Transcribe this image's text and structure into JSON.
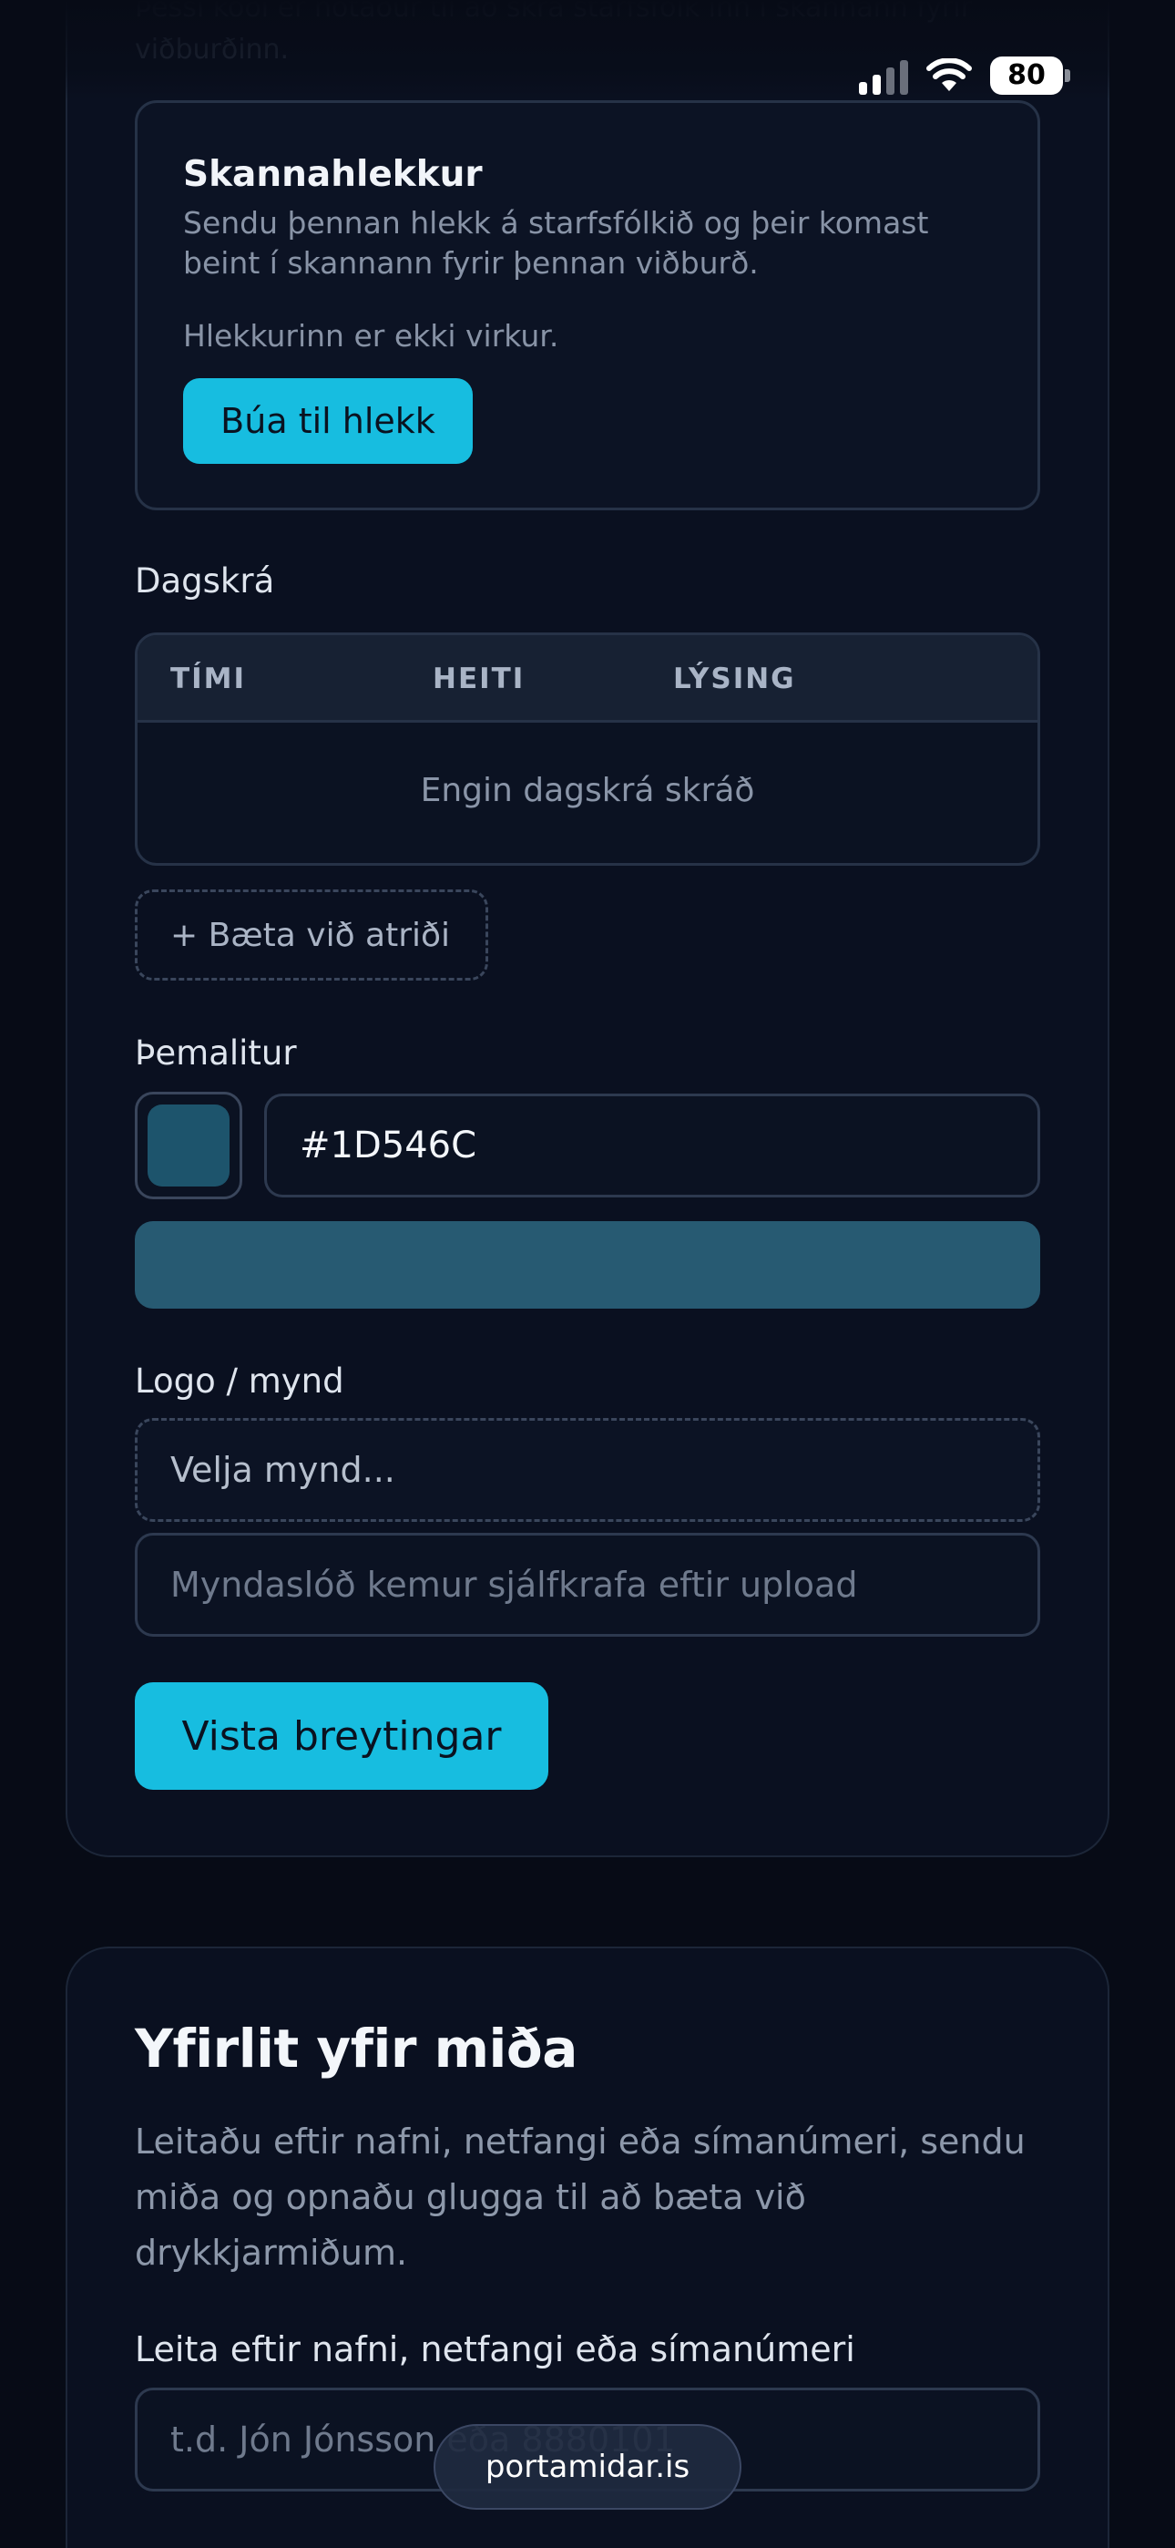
{
  "top_faded_text": "Þessi kóði er notaður til að skrá starfsfólk inn í skannann fyrir viðburðinn.",
  "status_bar": {
    "battery": "80"
  },
  "scan_link": {
    "title": "Skannahlekkur",
    "description": "Sendu þennan hlekk á starfsfólkið og þeir komast beint í skannann fyrir þennan viðburð.",
    "status": "Hlekkurinn er ekki virkur.",
    "button": "Búa til hlekk"
  },
  "agenda": {
    "label": "Dagskrá",
    "columns": [
      "TÍMI",
      "HEITI",
      "LÝSING"
    ],
    "empty": "Engin dagskrá skráð",
    "add_button": "+ Bæta við atriði"
  },
  "theme": {
    "label": "Þemalitur",
    "value": "#1D546C",
    "swatch_color": "#1D546C"
  },
  "logo": {
    "label": "Logo / mynd",
    "file_button": "Velja mynd...",
    "url_placeholder": "Myndaslóð kemur sjálfkrafa eftir upload"
  },
  "save_button": "Vista breytingar",
  "tickets": {
    "title": "Yfirlit yfir miða",
    "description": "Leitaðu eftir nafni, netfangi eða símanúmeri, sendu miða og opnaðu glugga til að bæta við drykkjarmiðum.",
    "search_label": "Leita eftir nafni, netfangi eða símanúmeri",
    "search_placeholder": "t.d. Jón Jónsson eða 8880101"
  },
  "browser": {
    "url": "portamidar.is"
  }
}
